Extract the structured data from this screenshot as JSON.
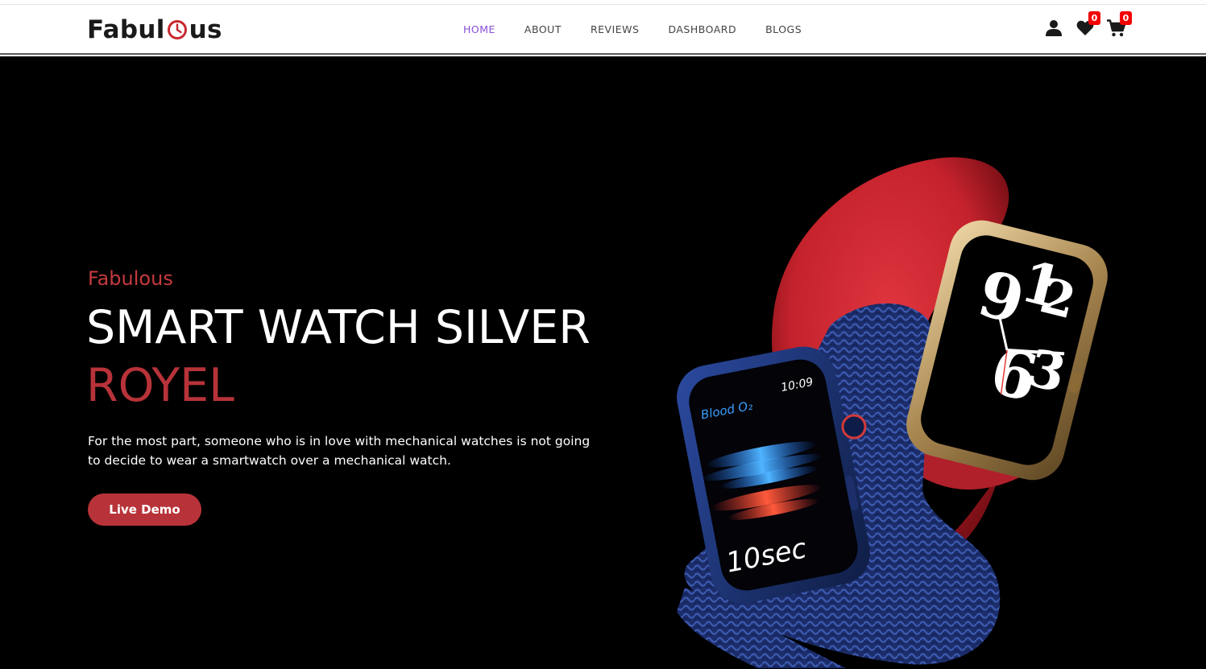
{
  "brand": {
    "logo_left": "Fabul",
    "logo_right": "us"
  },
  "nav": {
    "items": [
      {
        "label": "HOME",
        "active": true
      },
      {
        "label": "ABOUT",
        "active": false
      },
      {
        "label": "REVIEWS",
        "active": false
      },
      {
        "label": "DASHBOARD",
        "active": false
      },
      {
        "label": "BLOGS",
        "active": false
      }
    ]
  },
  "header_icons": {
    "user": "user-icon",
    "wishlist": {
      "icon": "heart-icon",
      "count": "0"
    },
    "cart": {
      "icon": "cart-icon",
      "count": "0"
    }
  },
  "hero": {
    "eyebrow": "Fabulous",
    "title_line1": "SMART WATCH SILVER",
    "title_line2": "ROYEL",
    "description": "For the most part, someone who is in love with mechanical watches is not going to decide to wear a smartwatch over a mechanical watch.",
    "cta_label": "Live Demo"
  },
  "watch_screens": {
    "front_label": "Blood O₂",
    "front_time": "10:09",
    "front_timer": "10sec",
    "back_face": "9 12 6 3"
  },
  "colors": {
    "accent": "#b73339",
    "nav_active": "#8a4fd8",
    "badge": "#f20000",
    "hero_bg": "#000000"
  }
}
